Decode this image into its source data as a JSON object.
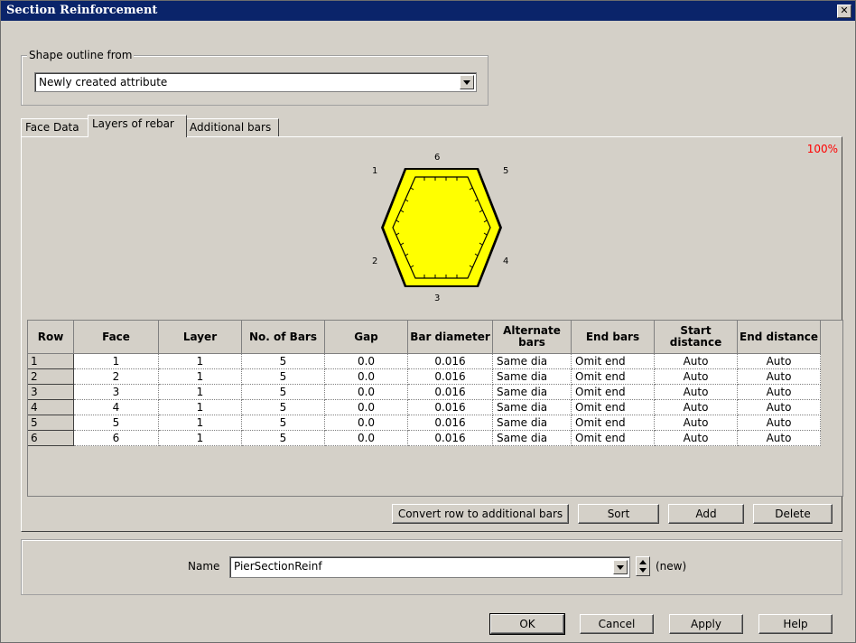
{
  "window": {
    "title": "Section Reinforcement",
    "close_glyph": "✕"
  },
  "shape_outline": {
    "group_label": "Shape outline from",
    "selected": "Newly created attribute"
  },
  "tabs": [
    {
      "label": "Face Data"
    },
    {
      "label": "Layers of rebar"
    },
    {
      "label": "Additional bars"
    }
  ],
  "preview": {
    "zoom": "100%",
    "face_labels": [
      "1",
      "2",
      "3",
      "4",
      "5",
      "6"
    ],
    "fill_color": "#ffff00",
    "outline_color": "#000000"
  },
  "grid": {
    "headers": [
      "Row",
      "Face",
      "Layer",
      "No. of Bars",
      "Gap",
      "Bar diameter",
      "Alternate bars",
      "End bars",
      "Start distance",
      "End distance"
    ],
    "rows": [
      [
        "1",
        "1",
        "1",
        "5",
        "0.0",
        "0.016",
        "Same dia",
        "Omit end",
        "Auto",
        "Auto"
      ],
      [
        "2",
        "2",
        "1",
        "5",
        "0.0",
        "0.016",
        "Same dia",
        "Omit end",
        "Auto",
        "Auto"
      ],
      [
        "3",
        "3",
        "1",
        "5",
        "0.0",
        "0.016",
        "Same dia",
        "Omit end",
        "Auto",
        "Auto"
      ],
      [
        "4",
        "4",
        "1",
        "5",
        "0.0",
        "0.016",
        "Same dia",
        "Omit end",
        "Auto",
        "Auto"
      ],
      [
        "5",
        "5",
        "1",
        "5",
        "0.0",
        "0.016",
        "Same dia",
        "Omit end",
        "Auto",
        "Auto"
      ],
      [
        "6",
        "6",
        "1",
        "5",
        "0.0",
        "0.016",
        "Same dia",
        "Omit end",
        "Auto",
        "Auto"
      ]
    ]
  },
  "grid_buttons": {
    "convert": "Convert row to additional bars",
    "sort": "Sort",
    "add": "Add",
    "delete": "Delete"
  },
  "name_field": {
    "label": "Name",
    "value": "PierSectionReinf",
    "status": "(new)"
  },
  "dialog_buttons": {
    "ok": "OK",
    "cancel": "Cancel",
    "apply": "Apply",
    "help": "Help"
  }
}
